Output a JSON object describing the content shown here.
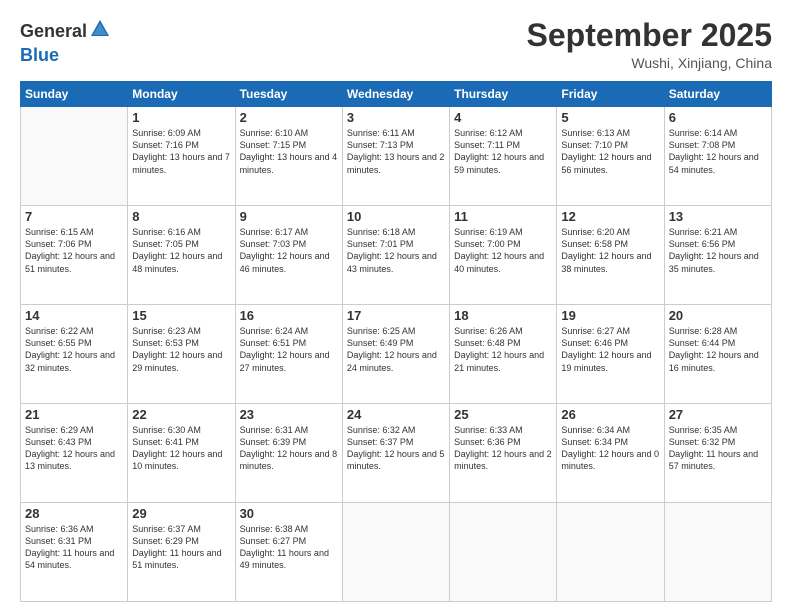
{
  "logo": {
    "general": "General",
    "blue": "Blue"
  },
  "header": {
    "month": "September 2025",
    "location": "Wushi, Xinjiang, China"
  },
  "days_of_week": [
    "Sunday",
    "Monday",
    "Tuesday",
    "Wednesday",
    "Thursday",
    "Friday",
    "Saturday"
  ],
  "weeks": [
    [
      {
        "day": "",
        "sunrise": "",
        "sunset": "",
        "daylight": ""
      },
      {
        "day": "1",
        "sunrise": "Sunrise: 6:09 AM",
        "sunset": "Sunset: 7:16 PM",
        "daylight": "Daylight: 13 hours and 7 minutes."
      },
      {
        "day": "2",
        "sunrise": "Sunrise: 6:10 AM",
        "sunset": "Sunset: 7:15 PM",
        "daylight": "Daylight: 13 hours and 4 minutes."
      },
      {
        "day": "3",
        "sunrise": "Sunrise: 6:11 AM",
        "sunset": "Sunset: 7:13 PM",
        "daylight": "Daylight: 13 hours and 2 minutes."
      },
      {
        "day": "4",
        "sunrise": "Sunrise: 6:12 AM",
        "sunset": "Sunset: 7:11 PM",
        "daylight": "Daylight: 12 hours and 59 minutes."
      },
      {
        "day": "5",
        "sunrise": "Sunrise: 6:13 AM",
        "sunset": "Sunset: 7:10 PM",
        "daylight": "Daylight: 12 hours and 56 minutes."
      },
      {
        "day": "6",
        "sunrise": "Sunrise: 6:14 AM",
        "sunset": "Sunset: 7:08 PM",
        "daylight": "Daylight: 12 hours and 54 minutes."
      }
    ],
    [
      {
        "day": "7",
        "sunrise": "Sunrise: 6:15 AM",
        "sunset": "Sunset: 7:06 PM",
        "daylight": "Daylight: 12 hours and 51 minutes."
      },
      {
        "day": "8",
        "sunrise": "Sunrise: 6:16 AM",
        "sunset": "Sunset: 7:05 PM",
        "daylight": "Daylight: 12 hours and 48 minutes."
      },
      {
        "day": "9",
        "sunrise": "Sunrise: 6:17 AM",
        "sunset": "Sunset: 7:03 PM",
        "daylight": "Daylight: 12 hours and 46 minutes."
      },
      {
        "day": "10",
        "sunrise": "Sunrise: 6:18 AM",
        "sunset": "Sunset: 7:01 PM",
        "daylight": "Daylight: 12 hours and 43 minutes."
      },
      {
        "day": "11",
        "sunrise": "Sunrise: 6:19 AM",
        "sunset": "Sunset: 7:00 PM",
        "daylight": "Daylight: 12 hours and 40 minutes."
      },
      {
        "day": "12",
        "sunrise": "Sunrise: 6:20 AM",
        "sunset": "Sunset: 6:58 PM",
        "daylight": "Daylight: 12 hours and 38 minutes."
      },
      {
        "day": "13",
        "sunrise": "Sunrise: 6:21 AM",
        "sunset": "Sunset: 6:56 PM",
        "daylight": "Daylight: 12 hours and 35 minutes."
      }
    ],
    [
      {
        "day": "14",
        "sunrise": "Sunrise: 6:22 AM",
        "sunset": "Sunset: 6:55 PM",
        "daylight": "Daylight: 12 hours and 32 minutes."
      },
      {
        "day": "15",
        "sunrise": "Sunrise: 6:23 AM",
        "sunset": "Sunset: 6:53 PM",
        "daylight": "Daylight: 12 hours and 29 minutes."
      },
      {
        "day": "16",
        "sunrise": "Sunrise: 6:24 AM",
        "sunset": "Sunset: 6:51 PM",
        "daylight": "Daylight: 12 hours and 27 minutes."
      },
      {
        "day": "17",
        "sunrise": "Sunrise: 6:25 AM",
        "sunset": "Sunset: 6:49 PM",
        "daylight": "Daylight: 12 hours and 24 minutes."
      },
      {
        "day": "18",
        "sunrise": "Sunrise: 6:26 AM",
        "sunset": "Sunset: 6:48 PM",
        "daylight": "Daylight: 12 hours and 21 minutes."
      },
      {
        "day": "19",
        "sunrise": "Sunrise: 6:27 AM",
        "sunset": "Sunset: 6:46 PM",
        "daylight": "Daylight: 12 hours and 19 minutes."
      },
      {
        "day": "20",
        "sunrise": "Sunrise: 6:28 AM",
        "sunset": "Sunset: 6:44 PM",
        "daylight": "Daylight: 12 hours and 16 minutes."
      }
    ],
    [
      {
        "day": "21",
        "sunrise": "Sunrise: 6:29 AM",
        "sunset": "Sunset: 6:43 PM",
        "daylight": "Daylight: 12 hours and 13 minutes."
      },
      {
        "day": "22",
        "sunrise": "Sunrise: 6:30 AM",
        "sunset": "Sunset: 6:41 PM",
        "daylight": "Daylight: 12 hours and 10 minutes."
      },
      {
        "day": "23",
        "sunrise": "Sunrise: 6:31 AM",
        "sunset": "Sunset: 6:39 PM",
        "daylight": "Daylight: 12 hours and 8 minutes."
      },
      {
        "day": "24",
        "sunrise": "Sunrise: 6:32 AM",
        "sunset": "Sunset: 6:37 PM",
        "daylight": "Daylight: 12 hours and 5 minutes."
      },
      {
        "day": "25",
        "sunrise": "Sunrise: 6:33 AM",
        "sunset": "Sunset: 6:36 PM",
        "daylight": "Daylight: 12 hours and 2 minutes."
      },
      {
        "day": "26",
        "sunrise": "Sunrise: 6:34 AM",
        "sunset": "Sunset: 6:34 PM",
        "daylight": "Daylight: 12 hours and 0 minutes."
      },
      {
        "day": "27",
        "sunrise": "Sunrise: 6:35 AM",
        "sunset": "Sunset: 6:32 PM",
        "daylight": "Daylight: 11 hours and 57 minutes."
      }
    ],
    [
      {
        "day": "28",
        "sunrise": "Sunrise: 6:36 AM",
        "sunset": "Sunset: 6:31 PM",
        "daylight": "Daylight: 11 hours and 54 minutes."
      },
      {
        "day": "29",
        "sunrise": "Sunrise: 6:37 AM",
        "sunset": "Sunset: 6:29 PM",
        "daylight": "Daylight: 11 hours and 51 minutes."
      },
      {
        "day": "30",
        "sunrise": "Sunrise: 6:38 AM",
        "sunset": "Sunset: 6:27 PM",
        "daylight": "Daylight: 11 hours and 49 minutes."
      },
      {
        "day": "",
        "sunrise": "",
        "sunset": "",
        "daylight": ""
      },
      {
        "day": "",
        "sunrise": "",
        "sunset": "",
        "daylight": ""
      },
      {
        "day": "",
        "sunrise": "",
        "sunset": "",
        "daylight": ""
      },
      {
        "day": "",
        "sunrise": "",
        "sunset": "",
        "daylight": ""
      }
    ]
  ]
}
